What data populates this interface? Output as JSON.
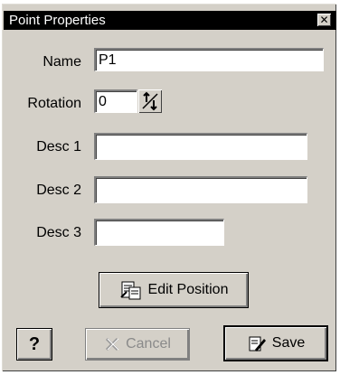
{
  "window": {
    "title": "Point Properties",
    "close_glyph": "✕"
  },
  "fields": {
    "name_label": "Name",
    "name_value": "P1",
    "rotation_label": "Rotation",
    "rotation_value": "0",
    "desc1_label": "Desc 1",
    "desc1_value": "",
    "desc2_label": "Desc 2",
    "desc2_value": "",
    "desc3_label": "Desc 3",
    "desc3_value": ""
  },
  "buttons": {
    "edit_position_label": "Edit Position",
    "help_label": "?",
    "cancel_label": "Cancel",
    "save_label": "Save"
  },
  "icons": {
    "close": "close-icon",
    "spinner": "up-down-arrows-icon",
    "edit_position": "document-edit-icon",
    "cancel": "x-icon",
    "save": "pencil-document-icon"
  }
}
